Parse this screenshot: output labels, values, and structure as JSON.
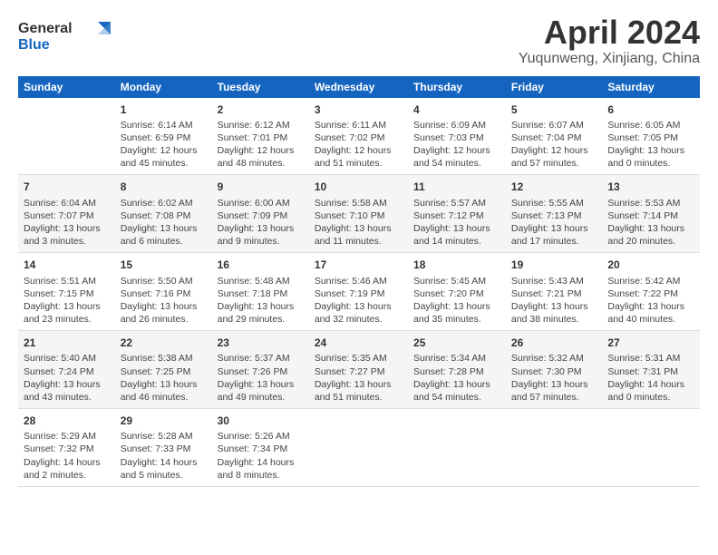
{
  "header": {
    "logo_line1": "General",
    "logo_line2": "Blue",
    "title": "April 2024",
    "location": "Yuqunweng, Xinjiang, China"
  },
  "columns": [
    "Sunday",
    "Monday",
    "Tuesday",
    "Wednesday",
    "Thursday",
    "Friday",
    "Saturday"
  ],
  "weeks": [
    [
      {
        "day": "",
        "info": ""
      },
      {
        "day": "1",
        "info": "Sunrise: 6:14 AM\nSunset: 6:59 PM\nDaylight: 12 hours\nand 45 minutes."
      },
      {
        "day": "2",
        "info": "Sunrise: 6:12 AM\nSunset: 7:01 PM\nDaylight: 12 hours\nand 48 minutes."
      },
      {
        "day": "3",
        "info": "Sunrise: 6:11 AM\nSunset: 7:02 PM\nDaylight: 12 hours\nand 51 minutes."
      },
      {
        "day": "4",
        "info": "Sunrise: 6:09 AM\nSunset: 7:03 PM\nDaylight: 12 hours\nand 54 minutes."
      },
      {
        "day": "5",
        "info": "Sunrise: 6:07 AM\nSunset: 7:04 PM\nDaylight: 12 hours\nand 57 minutes."
      },
      {
        "day": "6",
        "info": "Sunrise: 6:05 AM\nSunset: 7:05 PM\nDaylight: 13 hours\nand 0 minutes."
      }
    ],
    [
      {
        "day": "7",
        "info": "Sunrise: 6:04 AM\nSunset: 7:07 PM\nDaylight: 13 hours\nand 3 minutes."
      },
      {
        "day": "8",
        "info": "Sunrise: 6:02 AM\nSunset: 7:08 PM\nDaylight: 13 hours\nand 6 minutes."
      },
      {
        "day": "9",
        "info": "Sunrise: 6:00 AM\nSunset: 7:09 PM\nDaylight: 13 hours\nand 9 minutes."
      },
      {
        "day": "10",
        "info": "Sunrise: 5:58 AM\nSunset: 7:10 PM\nDaylight: 13 hours\nand 11 minutes."
      },
      {
        "day": "11",
        "info": "Sunrise: 5:57 AM\nSunset: 7:12 PM\nDaylight: 13 hours\nand 14 minutes."
      },
      {
        "day": "12",
        "info": "Sunrise: 5:55 AM\nSunset: 7:13 PM\nDaylight: 13 hours\nand 17 minutes."
      },
      {
        "day": "13",
        "info": "Sunrise: 5:53 AM\nSunset: 7:14 PM\nDaylight: 13 hours\nand 20 minutes."
      }
    ],
    [
      {
        "day": "14",
        "info": "Sunrise: 5:51 AM\nSunset: 7:15 PM\nDaylight: 13 hours\nand 23 minutes."
      },
      {
        "day": "15",
        "info": "Sunrise: 5:50 AM\nSunset: 7:16 PM\nDaylight: 13 hours\nand 26 minutes."
      },
      {
        "day": "16",
        "info": "Sunrise: 5:48 AM\nSunset: 7:18 PM\nDaylight: 13 hours\nand 29 minutes."
      },
      {
        "day": "17",
        "info": "Sunrise: 5:46 AM\nSunset: 7:19 PM\nDaylight: 13 hours\nand 32 minutes."
      },
      {
        "day": "18",
        "info": "Sunrise: 5:45 AM\nSunset: 7:20 PM\nDaylight: 13 hours\nand 35 minutes."
      },
      {
        "day": "19",
        "info": "Sunrise: 5:43 AM\nSunset: 7:21 PM\nDaylight: 13 hours\nand 38 minutes."
      },
      {
        "day": "20",
        "info": "Sunrise: 5:42 AM\nSunset: 7:22 PM\nDaylight: 13 hours\nand 40 minutes."
      }
    ],
    [
      {
        "day": "21",
        "info": "Sunrise: 5:40 AM\nSunset: 7:24 PM\nDaylight: 13 hours\nand 43 minutes."
      },
      {
        "day": "22",
        "info": "Sunrise: 5:38 AM\nSunset: 7:25 PM\nDaylight: 13 hours\nand 46 minutes."
      },
      {
        "day": "23",
        "info": "Sunrise: 5:37 AM\nSunset: 7:26 PM\nDaylight: 13 hours\nand 49 minutes."
      },
      {
        "day": "24",
        "info": "Sunrise: 5:35 AM\nSunset: 7:27 PM\nDaylight: 13 hours\nand 51 minutes."
      },
      {
        "day": "25",
        "info": "Sunrise: 5:34 AM\nSunset: 7:28 PM\nDaylight: 13 hours\nand 54 minutes."
      },
      {
        "day": "26",
        "info": "Sunrise: 5:32 AM\nSunset: 7:30 PM\nDaylight: 13 hours\nand 57 minutes."
      },
      {
        "day": "27",
        "info": "Sunrise: 5:31 AM\nSunset: 7:31 PM\nDaylight: 14 hours\nand 0 minutes."
      }
    ],
    [
      {
        "day": "28",
        "info": "Sunrise: 5:29 AM\nSunset: 7:32 PM\nDaylight: 14 hours\nand 2 minutes."
      },
      {
        "day": "29",
        "info": "Sunrise: 5:28 AM\nSunset: 7:33 PM\nDaylight: 14 hours\nand 5 minutes."
      },
      {
        "day": "30",
        "info": "Sunrise: 5:26 AM\nSunset: 7:34 PM\nDaylight: 14 hours\nand 8 minutes."
      },
      {
        "day": "",
        "info": ""
      },
      {
        "day": "",
        "info": ""
      },
      {
        "day": "",
        "info": ""
      },
      {
        "day": "",
        "info": ""
      }
    ]
  ]
}
